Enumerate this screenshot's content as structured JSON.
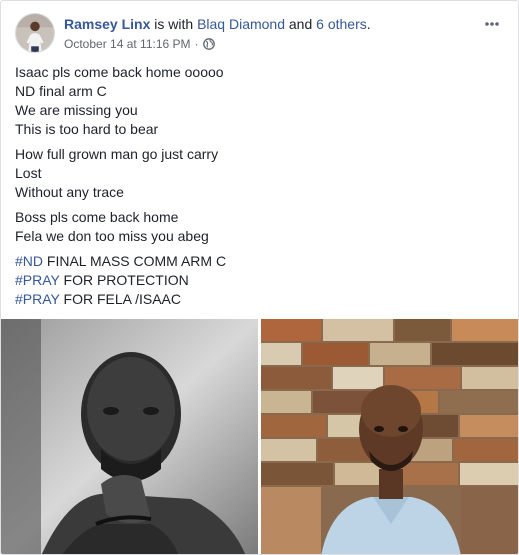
{
  "post": {
    "author_name": "Ramsey Linx",
    "with_text": " is with ",
    "tagged_person": "Blaq Diamond",
    "and_text": " and ",
    "others_text": "6 others",
    "period": ".",
    "timestamp": "October 14 at 11:16 PM",
    "separator": "·",
    "privacy_icon": "globe-icon",
    "options_icon": "more-options-icon"
  },
  "body": {
    "para1": [
      "Isaac pls come back home ooooo",
      "ND final arm C",
      "We are missing you",
      "This is too hard to bear"
    ],
    "para2": [
      "How full grown man go just carry",
      "Lost",
      "Without any trace"
    ],
    "para3": [
      "Boss pls come back home",
      "Fela we don too miss you abeg"
    ],
    "hashtag_lines": [
      {
        "tag": "#ND",
        "text": " FINAL MASS COMM ARM C"
      },
      {
        "tag": "#PRAY",
        "text": " FOR PROTECTION"
      },
      {
        "tag": "#PRAY",
        "text": " FOR FELA /ISAAC"
      }
    ]
  },
  "colors": {
    "link": "#365899",
    "text": "#1d2129",
    "meta": "#616770",
    "border": "#dddfe2"
  }
}
